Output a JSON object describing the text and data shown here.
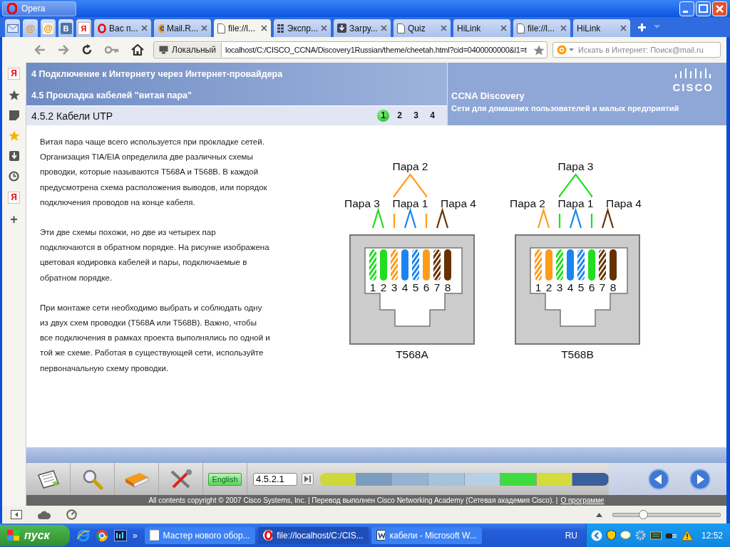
{
  "window": {
    "title": "Opera"
  },
  "pinned_tabs": [
    {
      "kind": "envelope"
    },
    {
      "kind": "glyph",
      "glyph": "@"
    },
    {
      "kind": "glyph-search",
      "glyph": "@"
    },
    {
      "kind": "badge",
      "glyph": "В"
    },
    {
      "kind": "badge-red",
      "glyph": "Я"
    }
  ],
  "tabs": [
    {
      "label": "Вас п...",
      "kind": "opera",
      "selected": false
    },
    {
      "label": "Mail.R...",
      "kind": "at",
      "selected": false
    },
    {
      "label": "file://l...",
      "kind": "page",
      "selected": true
    },
    {
      "label": "Экспр...",
      "kind": "grid",
      "selected": false
    },
    {
      "label": "Загру...",
      "kind": "download",
      "selected": false
    },
    {
      "label": "Quiz",
      "kind": "page",
      "selected": false
    },
    {
      "label": "HiLink",
      "selected": false
    },
    {
      "label": "file://l...",
      "kind": "page",
      "selected": false
    },
    {
      "label": "HiLink",
      "selected": false
    }
  ],
  "address_bar": {
    "location_badge": "Локальный",
    "url": "localhost/C:/CISCO_CCNA/Discovery1Russian/theme/cheetah.html?cid=0400000000&l1=t",
    "search": {
      "placeholder": "Искать в Интернет: Поиск@mail.ru"
    }
  },
  "side_panel": [
    {
      "kind": "glyph",
      "glyph": "Я"
    },
    {
      "kind": "star"
    },
    {
      "kind": "note"
    },
    {
      "kind": "star-gold"
    },
    {
      "kind": "download"
    },
    {
      "kind": "history"
    },
    {
      "kind": "glyph",
      "glyph": "Я"
    },
    {
      "kind": "plain",
      "glyph": "+"
    }
  ],
  "course": {
    "chapter": "4 Подключение к Интернету через Интернет-провайдера",
    "section": "4.5 Прокладка кабелей \"витая пара\"",
    "brand": "CCNA Discovery",
    "subtitle": "Сети для домашних пользователей и малых предприятий",
    "logo": "CISCO",
    "page_title": "4.5.2 Кабели UTP",
    "pages": [
      {
        "label": "1",
        "selected": true
      },
      {
        "label": "2",
        "selected": false
      },
      {
        "label": "3",
        "selected": false
      },
      {
        "label": "4",
        "selected": false
      }
    ]
  },
  "paragraphs": [
    "Витая пара чаще всего используется при прокладке сетей. Организация TIA/EIA определила две различных схемы проводки, которые называются T568A и T568B. В каждой предусмотрена схема расположения выводов, или порядок подключения проводов на конце кабеля.",
    "Эти две схемы похожи, но две из четырех пар подключаются в обратном порядке. На рисунке изображена цветовая кодировка кабелей и пары, подключаемые в обратном порядке.",
    "При монтаже сети необходимо выбрать и соблюдать одну из двух схем проводки (T568A или T568B). Важно, чтобы все подключения в рамках проекта выполнялись по одной и той же схеме. Работая в существующей сети, используйте первоначальную схему проводки."
  ],
  "connectors": [
    {
      "caption": "T568A",
      "pins": [
        {
          "number": "1",
          "color": "#22dd22",
          "striped": true
        },
        {
          "number": "2",
          "color": "#22dd22",
          "striped": false
        },
        {
          "number": "3",
          "color": "#ff9c1a",
          "striped": true
        },
        {
          "number": "4",
          "color": "#1a84f0",
          "striped": false
        },
        {
          "number": "5",
          "color": "#1a84f0",
          "striped": true
        },
        {
          "number": "6",
          "color": "#ff9c1a",
          "striped": false
        },
        {
          "number": "7",
          "color": "#663300",
          "striped": true
        },
        {
          "number": "8",
          "color": "#663300",
          "striped": false
        }
      ],
      "pairs": [
        {
          "label": "Пара 3",
          "color": "#22dd22"
        },
        {
          "label": "Пара 2",
          "color": "#ff9c1a"
        },
        {
          "label": "Пара 1",
          "color": "#1a84f0"
        },
        {
          "label": "Пара 4",
          "color": "#663300"
        }
      ]
    },
    {
      "caption": "T568B",
      "pins": [
        {
          "number": "1",
          "color": "#ff9c1a",
          "striped": true
        },
        {
          "number": "2",
          "color": "#ff9c1a",
          "striped": false
        },
        {
          "number": "3",
          "color": "#22dd22",
          "striped": true
        },
        {
          "number": "4",
          "color": "#1a84f0",
          "striped": false
        },
        {
          "number": "5",
          "color": "#1a84f0",
          "striped": true
        },
        {
          "number": "6",
          "color": "#22dd22",
          "striped": false
        },
        {
          "number": "7",
          "color": "#663300",
          "striped": true
        },
        {
          "number": "8",
          "color": "#663300",
          "striped": false
        }
      ],
      "pairs": [
        {
          "label": "Пара 2",
          "color": "#ff9c1a"
        },
        {
          "label": "Пара 3",
          "color": "#22dd22"
        },
        {
          "label": "Пара 1",
          "color": "#1a84f0"
        },
        {
          "label": "Пара 4",
          "color": "#663300"
        }
      ]
    }
  ],
  "player": {
    "tools": [
      {
        "kind": "notes"
      },
      {
        "kind": "search"
      },
      {
        "kind": "book"
      },
      {
        "kind": "tools"
      }
    ],
    "language": "English",
    "page_field": "4.5.2.1",
    "progress": [
      {
        "color": "#cdd83a"
      },
      {
        "color": "#7c9cc0"
      },
      {
        "color": "#95b3d0"
      },
      {
        "color": "#a6c2dc"
      },
      {
        "color": "#b6d0e6"
      },
      {
        "color": "#3fdc3f"
      },
      {
        "color": "#d4dc3c"
      },
      {
        "color": "#3a5f9a"
      }
    ],
    "copyright": "All contents copyright © 2007 Cisco Systems, Inc. | Перевод выполнен Cisco Networking Academy (Сетевая академия Cisco). |",
    "about_link": "О программе"
  },
  "status_bar": {
    "zoom": {
      "level": 0.28
    }
  },
  "taskbar": {
    "start": "пуск",
    "quick_launch": [
      {
        "kind": "ie"
      },
      {
        "kind": "chrome"
      },
      {
        "kind": "media"
      }
    ],
    "more": "»",
    "tasks": [
      {
        "label": "Мастер нового обор...",
        "kind": "window",
        "selected": false
      },
      {
        "label": "file://localhost/C:/CIS...",
        "kind": "opera",
        "selected": true
      },
      {
        "label": "кабели - Microsoft W...",
        "kind": "word",
        "selected": false
      }
    ],
    "language": "RU",
    "clock": "12:52"
  }
}
